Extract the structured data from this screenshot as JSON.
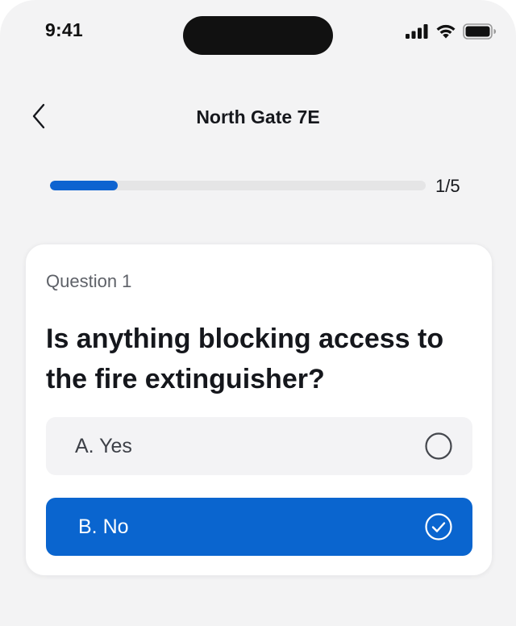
{
  "status_bar": {
    "time": "9:41",
    "icons": [
      "cellular-signal-icon",
      "wifi-icon",
      "battery-icon"
    ]
  },
  "header": {
    "back_icon": "chevron-left-icon",
    "title": "North Gate 7E"
  },
  "progress": {
    "current": 1,
    "total": 5,
    "label": "1/5",
    "fill_fraction": 0.18
  },
  "question": {
    "number_label": "Question 1",
    "text": "Is anything blocking access to the fire extinguisher?",
    "options": [
      {
        "label": "A. Yes",
        "selected": false,
        "icon": "radio-empty-icon"
      },
      {
        "label": "B. No",
        "selected": true,
        "icon": "check-circle-icon"
      }
    ]
  },
  "colors": {
    "accent": "#0A65CF",
    "background": "#F3F3F4",
    "card": "#FFFFFF",
    "option_unselected_bg": "#F3F3F5",
    "progress_track": "#E5E5E6"
  }
}
